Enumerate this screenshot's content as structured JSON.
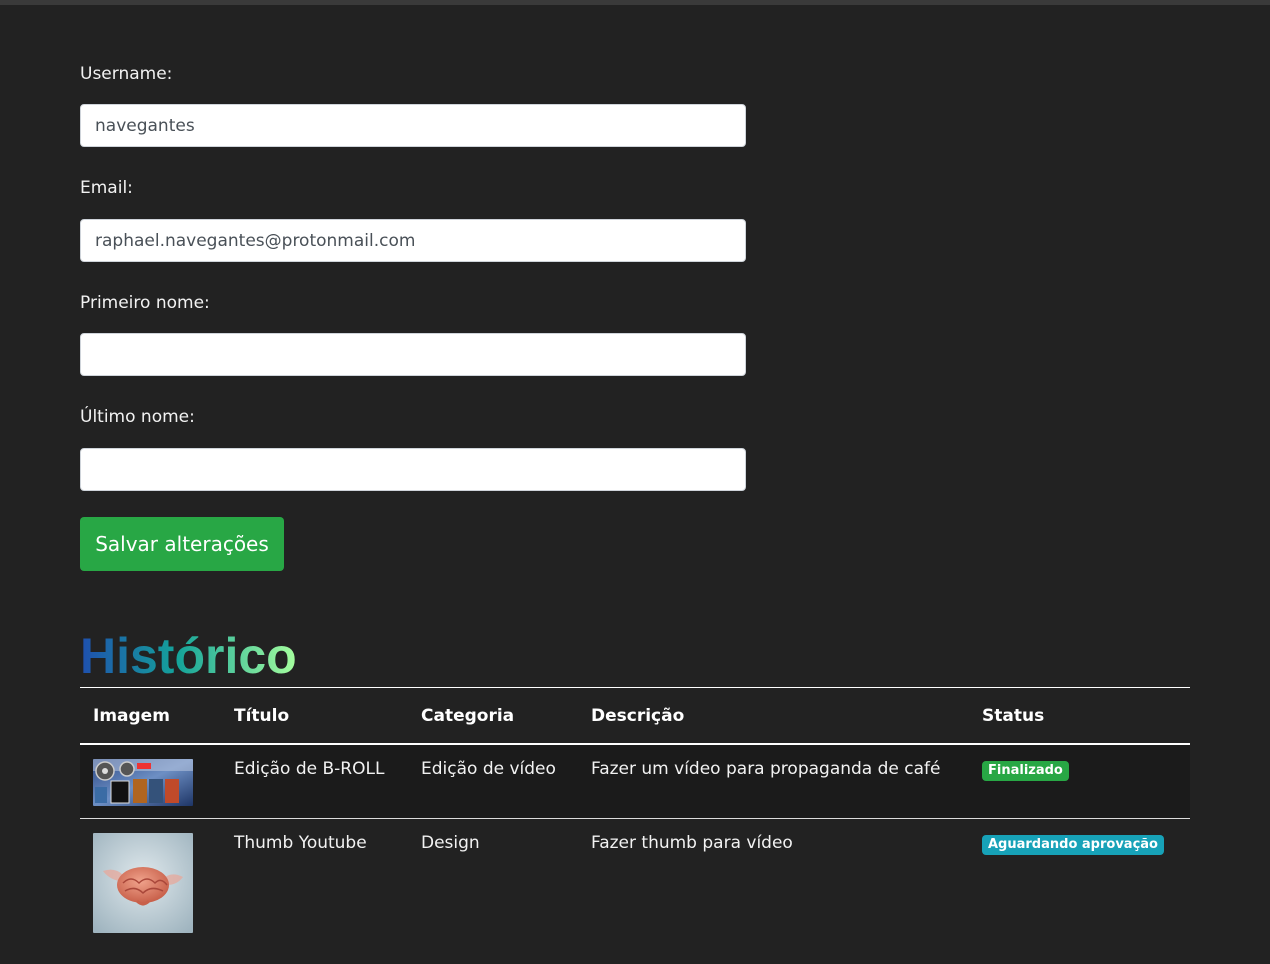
{
  "form": {
    "username_label": "Username:",
    "username_value": "navegantes",
    "email_label": "Email:",
    "email_value": "raphael.navegantes@protonmail.com",
    "first_name_label": "Primeiro nome:",
    "first_name_value": "",
    "last_name_label": "Último nome:",
    "last_name_value": "",
    "save_label": "Salvar alterações"
  },
  "history": {
    "title": "Histórico",
    "columns": [
      "Imagem",
      "Título",
      "Categoria",
      "Descrição",
      "Status"
    ],
    "rows": [
      {
        "title": "Edição de B-ROLL",
        "category": "Edição de vídeo",
        "description": "Fazer um vídeo para propaganda de café",
        "status": "Finalizado",
        "status_color": "#28a745"
      },
      {
        "title": "Thumb Youtube",
        "category": "Design",
        "description": "Fazer thumb para vídeo",
        "status": "Aguardando aprovação",
        "status_color": "#17a2b8"
      }
    ]
  },
  "colors": {
    "background": "#222222",
    "success": "#28a745",
    "info": "#17a2b8"
  }
}
